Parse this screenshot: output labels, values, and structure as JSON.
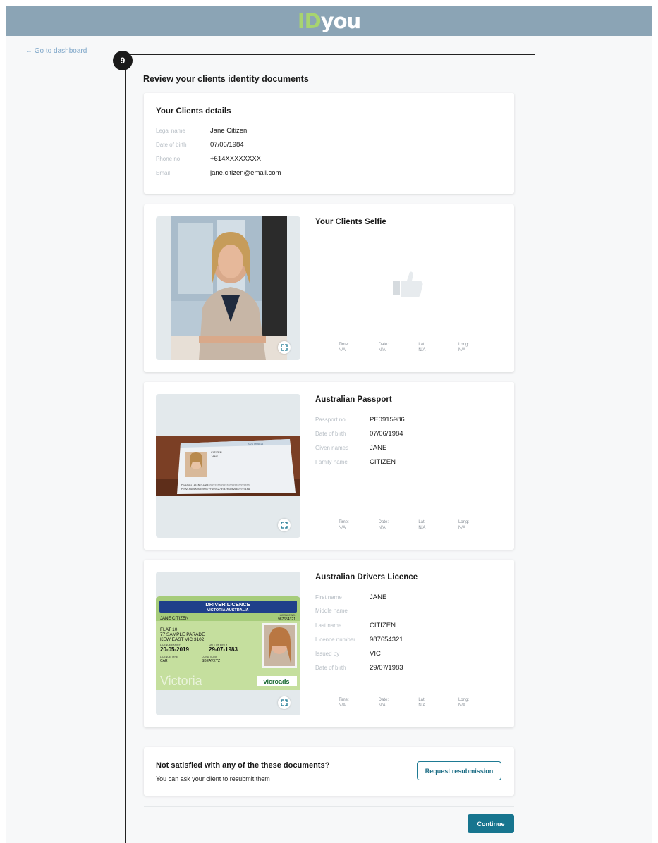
{
  "brand": {
    "logo_id": "ID",
    "logo_you": "you"
  },
  "nav": {
    "back_label": "← Go to dashboard"
  },
  "step": {
    "number": "9"
  },
  "page": {
    "title": "Review your clients identity documents"
  },
  "client_details": {
    "title": "Your Clients details",
    "fields": [
      {
        "label": "Legal name",
        "value": "Jane Citizen"
      },
      {
        "label": "Date of birth",
        "value": "07/06/1984"
      },
      {
        "label": "Phone no.",
        "value": "+614XXXXXXXX"
      },
      {
        "label": "Email",
        "value": "jane.citizen@email.com"
      }
    ]
  },
  "documents": [
    {
      "title": "Your Clients Selfie",
      "fields": [],
      "meta": [
        {
          "label": "Time:",
          "value": "N/A"
        },
        {
          "label": "Date:",
          "value": "N/A"
        },
        {
          "label": "Lat:",
          "value": "N/A"
        },
        {
          "label": "Long:",
          "value": "N/A"
        }
      ]
    },
    {
      "title": "Australian Passport",
      "fields": [
        {
          "label": "Passport no.",
          "value": "PE0915986"
        },
        {
          "label": "Date of birth",
          "value": "07/06/1984"
        },
        {
          "label": "Given names",
          "value": "JANE"
        },
        {
          "label": "Family name",
          "value": "CITIZEN"
        }
      ],
      "meta": [
        {
          "label": "Time:",
          "value": "N/A"
        },
        {
          "label": "Date:",
          "value": "N/A"
        },
        {
          "label": "Lat:",
          "value": "N/A"
        },
        {
          "label": "Long:",
          "value": "N/A"
        }
      ]
    },
    {
      "title": "Australian Drivers Licence",
      "fields": [
        {
          "label": "First name",
          "value": "JANE"
        },
        {
          "label": "Middle name",
          "value": ""
        },
        {
          "label": "Last name",
          "value": "CITIZEN"
        },
        {
          "label": "Licence number",
          "value": "987654321"
        },
        {
          "label": "Issued by",
          "value": "VIC"
        },
        {
          "label": "Date of birth",
          "value": "29/07/1983"
        }
      ],
      "meta": [
        {
          "label": "Time:",
          "value": "N/A"
        },
        {
          "label": "Date:",
          "value": "N/A"
        },
        {
          "label": "Lat:",
          "value": "N/A"
        },
        {
          "label": "Long:",
          "value": "N/A"
        }
      ]
    }
  ],
  "passport_image": {
    "header": "AUSTRALIA",
    "surname": "CITIZEN",
    "given": "JANE",
    "mrz_1": "P<AUSCITIZEN<<JANE<<<<<<<<<<<<<<<<<<<<<<<<<<<",
    "mrz_2": "PE0915986AUS8406077F1905278<4205809665<<<<10A"
  },
  "licence_image": {
    "header_1": "DRIVER LICENCE",
    "header_2": "VICTORIA AUSTRALIA",
    "name": "JANE CITIZEN",
    "licence_no_label": "LICENCE NO.",
    "licence_no": "987654321",
    "address_1": "FLAT 10",
    "address_2": "77 SAMPLE PARADE",
    "address_3": "KEW EAST VIC 3102",
    "expiry_label": "LICENCE EXPIRY",
    "expiry": "20-05-2019",
    "dob_label": "DATE OF BIRTH",
    "dob": "29-07-1983",
    "type_label": "LICENCE TYPE",
    "type": "CAR",
    "conditions_label": "CONDITIONS",
    "conditions": "SBEAVXYZ",
    "state_word": "Victoria",
    "vicroads": "vicroads"
  },
  "resubmit": {
    "title": "Not satisfied with any of the these documents?",
    "subtitle": "You can ask your client to resubmit them",
    "button_label": "Request resubmission"
  },
  "footer": {
    "continue_label": "Continue"
  },
  "colors": {
    "topbar": "#8ba4b5",
    "logo_accent": "#a8d46f",
    "primary": "#17758f",
    "link": "#7fa7c9"
  }
}
